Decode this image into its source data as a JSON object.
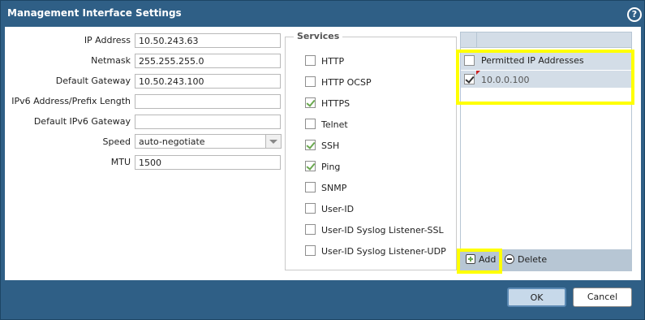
{
  "dialog": {
    "title": "Management Interface Settings",
    "help_label": "?"
  },
  "form": {
    "ip_address": {
      "label": "IP Address",
      "value": "10.50.243.63"
    },
    "netmask": {
      "label": "Netmask",
      "value": "255.255.255.0"
    },
    "default_gateway": {
      "label": "Default Gateway",
      "value": "10.50.243.100"
    },
    "ipv6_address": {
      "label": "IPv6 Address/Prefix Length",
      "value": ""
    },
    "default_ipv6_gateway": {
      "label": "Default IPv6 Gateway",
      "value": ""
    },
    "speed": {
      "label": "Speed",
      "value": "auto-negotiate"
    },
    "mtu": {
      "label": "MTU",
      "value": "1500"
    }
  },
  "services": {
    "legend": "Services",
    "items": [
      {
        "label": "HTTP",
        "checked": false
      },
      {
        "label": "HTTP OCSP",
        "checked": false
      },
      {
        "label": "HTTPS",
        "checked": true
      },
      {
        "label": "Telnet",
        "checked": false
      },
      {
        "label": "SSH",
        "checked": true
      },
      {
        "label": "Ping",
        "checked": true
      },
      {
        "label": "SNMP",
        "checked": false
      },
      {
        "label": "User-ID",
        "checked": false
      },
      {
        "label": "User-ID Syslog Listener-SSL",
        "checked": false
      },
      {
        "label": "User-ID Syslog Listener-UDP",
        "checked": false
      }
    ]
  },
  "permitted": {
    "header": "Permitted IP Addresses",
    "rows": [
      {
        "value": "10.0.0.100",
        "checked": true
      }
    ],
    "add_label": "Add",
    "delete_label": "Delete"
  },
  "buttons": {
    "ok": "OK",
    "cancel": "Cancel"
  },
  "colors": {
    "frame": "#2f5f86",
    "highlight": "#ffff00",
    "grid_header": "#d3dde7",
    "check_green": "#6aa84f"
  }
}
